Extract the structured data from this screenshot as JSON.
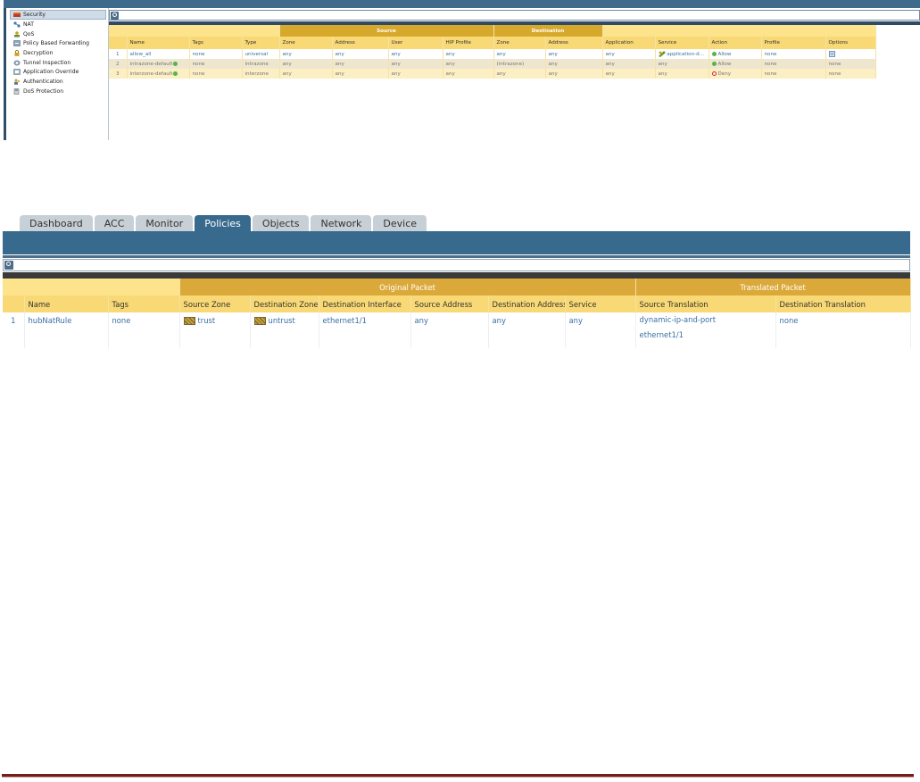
{
  "sidebar": {
    "items": [
      {
        "label": "Security",
        "icon": "security-icon",
        "selected": true
      },
      {
        "label": "NAT",
        "icon": "nat-icon"
      },
      {
        "label": "QoS",
        "icon": "qos-icon"
      },
      {
        "label": "Policy Based Forwarding",
        "icon": "pbf-icon"
      },
      {
        "label": "Decryption",
        "icon": "lock-icon"
      },
      {
        "label": "Tunnel Inspection",
        "icon": "tunnel-icon"
      },
      {
        "label": "Application Override",
        "icon": "override-icon"
      },
      {
        "label": "Authentication",
        "icon": "users-icon"
      },
      {
        "label": "DoS Protection",
        "icon": "shield-icon"
      }
    ]
  },
  "security_table": {
    "groups": {
      "source": "Source",
      "destination": "Destination"
    },
    "headers": [
      "",
      "Name",
      "Tags",
      "Type",
      "Zone",
      "Address",
      "User",
      "HIP Profile",
      "Zone",
      "Address",
      "Application",
      "Service",
      "Action",
      "Profile",
      "Options"
    ],
    "rows": [
      [
        "1",
        "allow_all",
        "none",
        "universal",
        "any",
        "any",
        "any",
        "any",
        "any",
        "any",
        "any",
        "application-d...",
        "Allow",
        "none",
        ""
      ],
      [
        "2",
        "intrazone-default",
        "none",
        "intrazone",
        "any",
        "any",
        "any",
        "any",
        "(intrazone)",
        "any",
        "any",
        "any",
        "Allow",
        "none",
        "none"
      ],
      [
        "3",
        "interzone-default",
        "none",
        "interzone",
        "any",
        "any",
        "any",
        "any",
        "any",
        "any",
        "any",
        "any",
        "Deny",
        "none",
        "none"
      ]
    ]
  },
  "tabs": [
    "Dashboard",
    "ACC",
    "Monitor",
    "Policies",
    "Objects",
    "Network",
    "Device"
  ],
  "active_tab": "Policies",
  "nat_table": {
    "groups": {
      "original": "Original Packet",
      "translated": "Translated Packet"
    },
    "headers": [
      "",
      "Name",
      "Tags",
      "Source Zone",
      "Destination Zone",
      "Destination Interface",
      "Source Address",
      "Destination Address",
      "Service",
      "Source Translation",
      "Destination Translation"
    ],
    "row": {
      "num": "1",
      "name": "hubNatRule",
      "tags": "none",
      "source_zone": "trust",
      "destination_zone": "untrust",
      "destination_interface": "ethernet1/1",
      "source_address": "any",
      "destination_address": "any",
      "service": "any",
      "source_translation_type": "dynamic-ip-and-port",
      "source_translation_iface": "ethernet1/1",
      "destination_translation": "none"
    }
  },
  "colors": {
    "header_blue": "#386a8e",
    "group_gold": "#d6a92c",
    "header_yellow": "#f9d975",
    "link_blue": "#3a6fa3",
    "allow_green": "#59b34a",
    "deny_red": "#d02d2d",
    "footer_maroon": "#7a1c1c"
  }
}
